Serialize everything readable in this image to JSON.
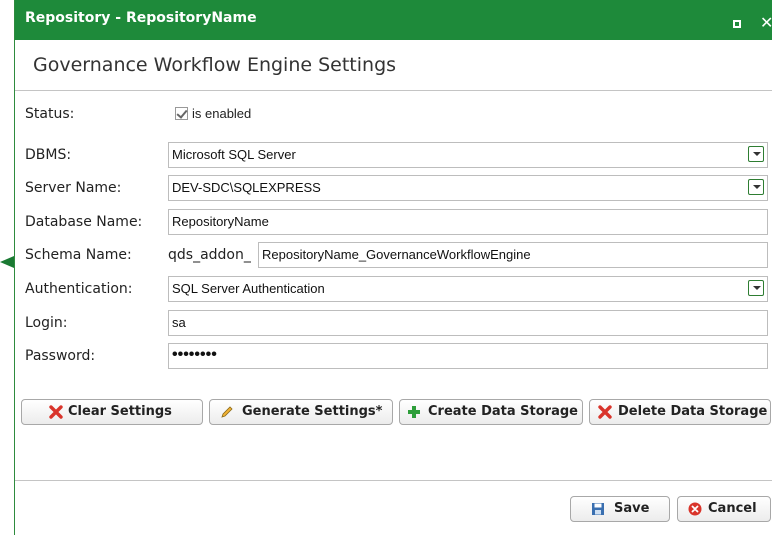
{
  "window": {
    "title": "Repository - RepositoryName"
  },
  "header": {
    "title": "Governance Workflow Engine Settings"
  },
  "form": {
    "status_label": "Status:",
    "status_checkbox_label": "is enabled",
    "status_checked": true,
    "dbms_label": "DBMS:",
    "dbms_value": "Microsoft SQL Server",
    "server_label": "Server Name:",
    "server_value": "DEV-SDC\\SQLEXPRESS",
    "database_label": "Database Name:",
    "database_value": "RepositoryName",
    "schema_label": "Schema Name:",
    "schema_prefix": "qds_addon_",
    "schema_value": "RepositoryName_GovernanceWorkflowEngine",
    "auth_label": "Authentication:",
    "auth_value": "SQL Server Authentication",
    "login_label": "Login:",
    "login_value": "sa",
    "password_label": "Password:",
    "password_value": "••••••••"
  },
  "actions": {
    "clear": "Clear Settings",
    "generate": "Generate Settings*",
    "create": "Create Data Storage",
    "delete": "Delete Data Storage"
  },
  "footer": {
    "save": "Save",
    "cancel": "Cancel"
  },
  "colors": {
    "titlebar": "#1e8a3a",
    "delete_red": "#d9342b",
    "add_green": "#2e9e3a"
  }
}
